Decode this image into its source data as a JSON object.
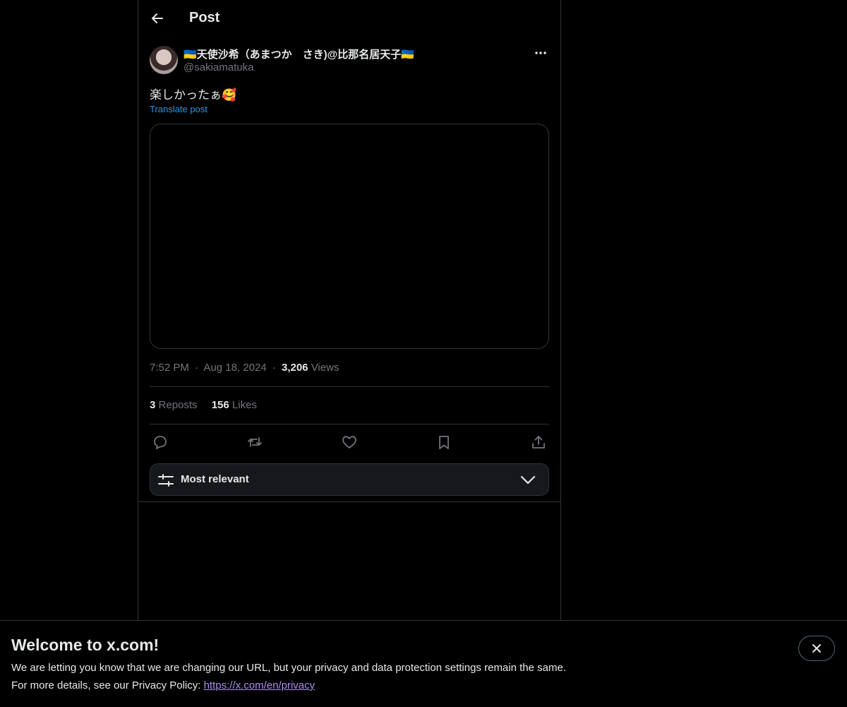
{
  "header": {
    "title": "Post",
    "back_icon": "arrow-left-icon"
  },
  "author": {
    "display_name": "🇺🇦天使沙希（あまつか　さき)@比那名居天子🇺🇦",
    "handle": "@sakiamatuka",
    "more_icon": "more-horizontal-icon"
  },
  "post": {
    "text": "楽しかったぁ🥰",
    "translate_label": "Translate post",
    "time": "7:52 PM",
    "separator": "·",
    "date": "Aug 18, 2024",
    "views_count": "3,206",
    "views_label": "Views"
  },
  "stats": {
    "reposts_count": "3",
    "reposts_label": "Reposts",
    "likes_count": "156",
    "likes_label": "Likes"
  },
  "actions": [
    "reply-icon",
    "repost-icon",
    "like-icon",
    "bookmark-icon",
    "share-icon"
  ],
  "sort": {
    "label": "Most relevant",
    "icon": "sliders-icon",
    "chevron_icon": "chevron-down-icon"
  },
  "banner": {
    "title": "Welcome to x.com!",
    "line1": "We are letting you know that we are changing our URL, but your privacy and data protection settings remain the same.",
    "line2_prefix": "For more details, see our Privacy Policy: ",
    "link_text": "https://x.com/en/privacy",
    "close_icon": "close-icon"
  },
  "colors": {
    "background": "#000000",
    "text_primary": "#e7e9ea",
    "text_secondary": "#71767b",
    "accent": "#1d9bf0",
    "border": "#2f3336",
    "link_visited": "#a98ee8"
  }
}
